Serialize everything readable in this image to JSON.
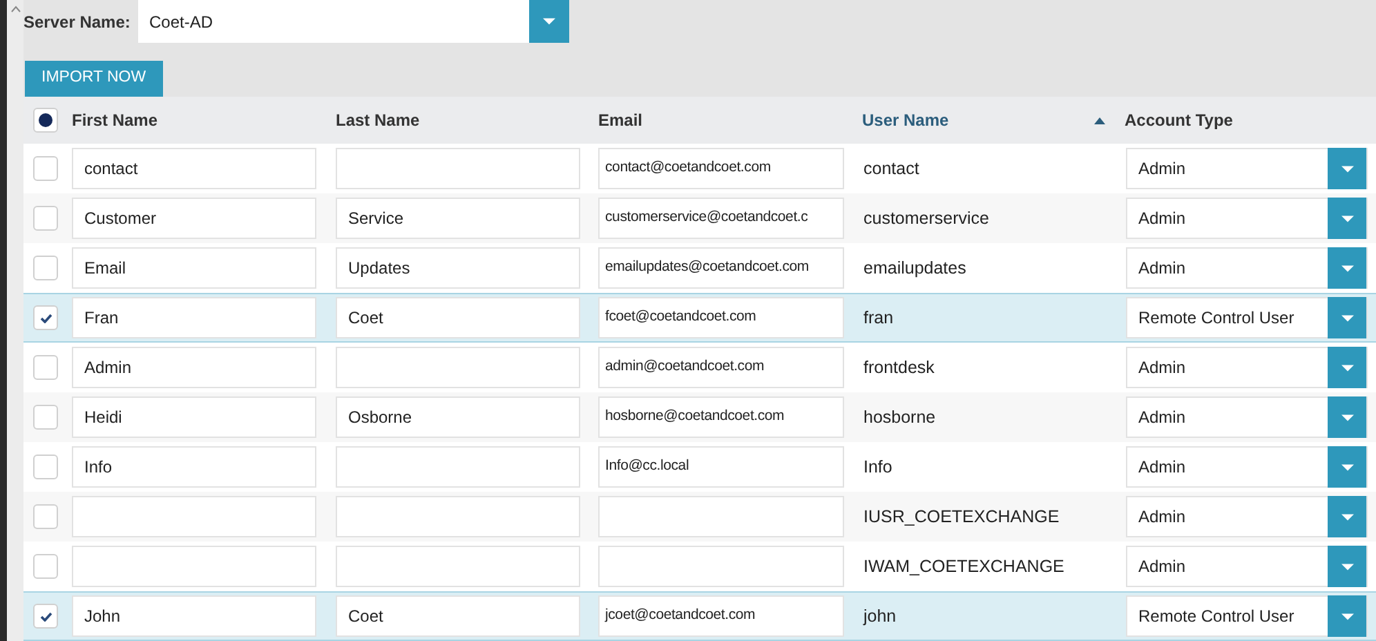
{
  "server": {
    "label": "Server Name:",
    "value": "Coet-AD"
  },
  "import_button": "IMPORT NOW",
  "select_all": {
    "checked": true
  },
  "columns": [
    {
      "label": "First Name",
      "sorted": false
    },
    {
      "label": "Last Name",
      "sorted": false
    },
    {
      "label": "Email",
      "sorted": false
    },
    {
      "label": "User Name",
      "sorted": true
    },
    {
      "label": "Account Type",
      "sorted": false
    }
  ],
  "rows": [
    {
      "selected": false,
      "first_name": "contact",
      "last_name": "",
      "email": "contact@coetandcoet.com",
      "user_name": "contact",
      "account_type": "Admin"
    },
    {
      "selected": false,
      "first_name": "Customer",
      "last_name": "Service",
      "email": "customerservice@coetandcoet.c",
      "user_name": "customerservice",
      "account_type": "Admin"
    },
    {
      "selected": false,
      "first_name": "Email",
      "last_name": "Updates",
      "email": "emailupdates@coetandcoet.com",
      "user_name": "emailupdates",
      "account_type": "Admin"
    },
    {
      "selected": true,
      "first_name": "Fran",
      "last_name": "Coet",
      "email": "fcoet@coetandcoet.com",
      "user_name": "fran",
      "account_type": "Remote Control User"
    },
    {
      "selected": false,
      "first_name": "Admin",
      "last_name": "",
      "email": "admin@coetandcoet.com",
      "user_name": "frontdesk",
      "account_type": "Admin"
    },
    {
      "selected": false,
      "first_name": "Heidi",
      "last_name": "Osborne",
      "email": "hosborne@coetandcoet.com",
      "user_name": "hosborne",
      "account_type": "Admin"
    },
    {
      "selected": false,
      "first_name": "Info",
      "last_name": "",
      "email": "Info@cc.local",
      "user_name": "Info",
      "account_type": "Admin"
    },
    {
      "selected": false,
      "first_name": "",
      "last_name": "",
      "email": "",
      "user_name": "IUSR_COETEXCHANGE",
      "account_type": "Admin"
    },
    {
      "selected": false,
      "first_name": "",
      "last_name": "",
      "email": "",
      "user_name": "IWAM_COETEXCHANGE",
      "account_type": "Admin"
    },
    {
      "selected": true,
      "first_name": "John",
      "last_name": "Coet",
      "email": "jcoet@coetandcoet.com",
      "user_name": "john",
      "account_type": "Remote Control User"
    }
  ]
}
